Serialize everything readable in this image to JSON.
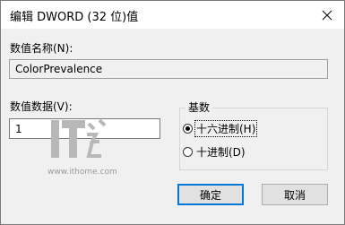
{
  "window": {
    "title": "编辑 DWORD (32 位)值"
  },
  "value_name": {
    "label": "数值名称(N):",
    "value": "ColorPrevalence"
  },
  "value_data": {
    "label": "数值数据(V):",
    "value": "1"
  },
  "base": {
    "title": "基数",
    "options": [
      {
        "label": "十六进制(H)",
        "selected": true
      },
      {
        "label": "十进制(D)",
        "selected": false
      }
    ]
  },
  "buttons": {
    "ok": "确定",
    "cancel": "取消"
  },
  "watermark": {
    "logo_text": "IT之家",
    "url": "www.ithome.com"
  },
  "icons": {
    "close": "close-icon",
    "logo": "ithome-logo"
  },
  "colors": {
    "accent": "#0078d7",
    "dialog_bg": "#f0f0f0",
    "watermark": "#b8b8b8"
  }
}
